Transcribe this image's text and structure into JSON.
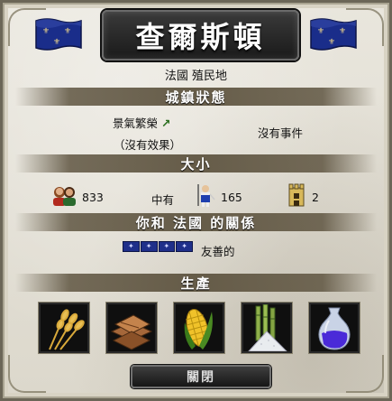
{
  "window": {
    "title": "查爾斯頓",
    "subtitle": "法國  殖民地"
  },
  "sections": {
    "town_status": "城鎮狀態",
    "size": "大小",
    "relations": "你和  法國  的關係",
    "production": "生產"
  },
  "status": {
    "prosperity_label": "景氣繁榮",
    "prosperity_arrow": "↗",
    "effect": "（沒有效果）",
    "events": "沒有事件"
  },
  "size": {
    "population": "833",
    "size_label": "中有",
    "soldiers": "165",
    "buildings": "2"
  },
  "relations": {
    "stars_symbol": "✦",
    "attitude": "友善的"
  },
  "production": {
    "items": [
      "wheat-icon",
      "lumber-icon",
      "corn-icon",
      "sugarcane-icon",
      "potion-icon"
    ]
  },
  "buttons": {
    "close_label": "關閉"
  },
  "colors": {
    "flag_blue": "#1a2d8a",
    "band": "#5f5541",
    "title_bg": "#1a1a1a",
    "arrow": "#2a6e1e"
  }
}
